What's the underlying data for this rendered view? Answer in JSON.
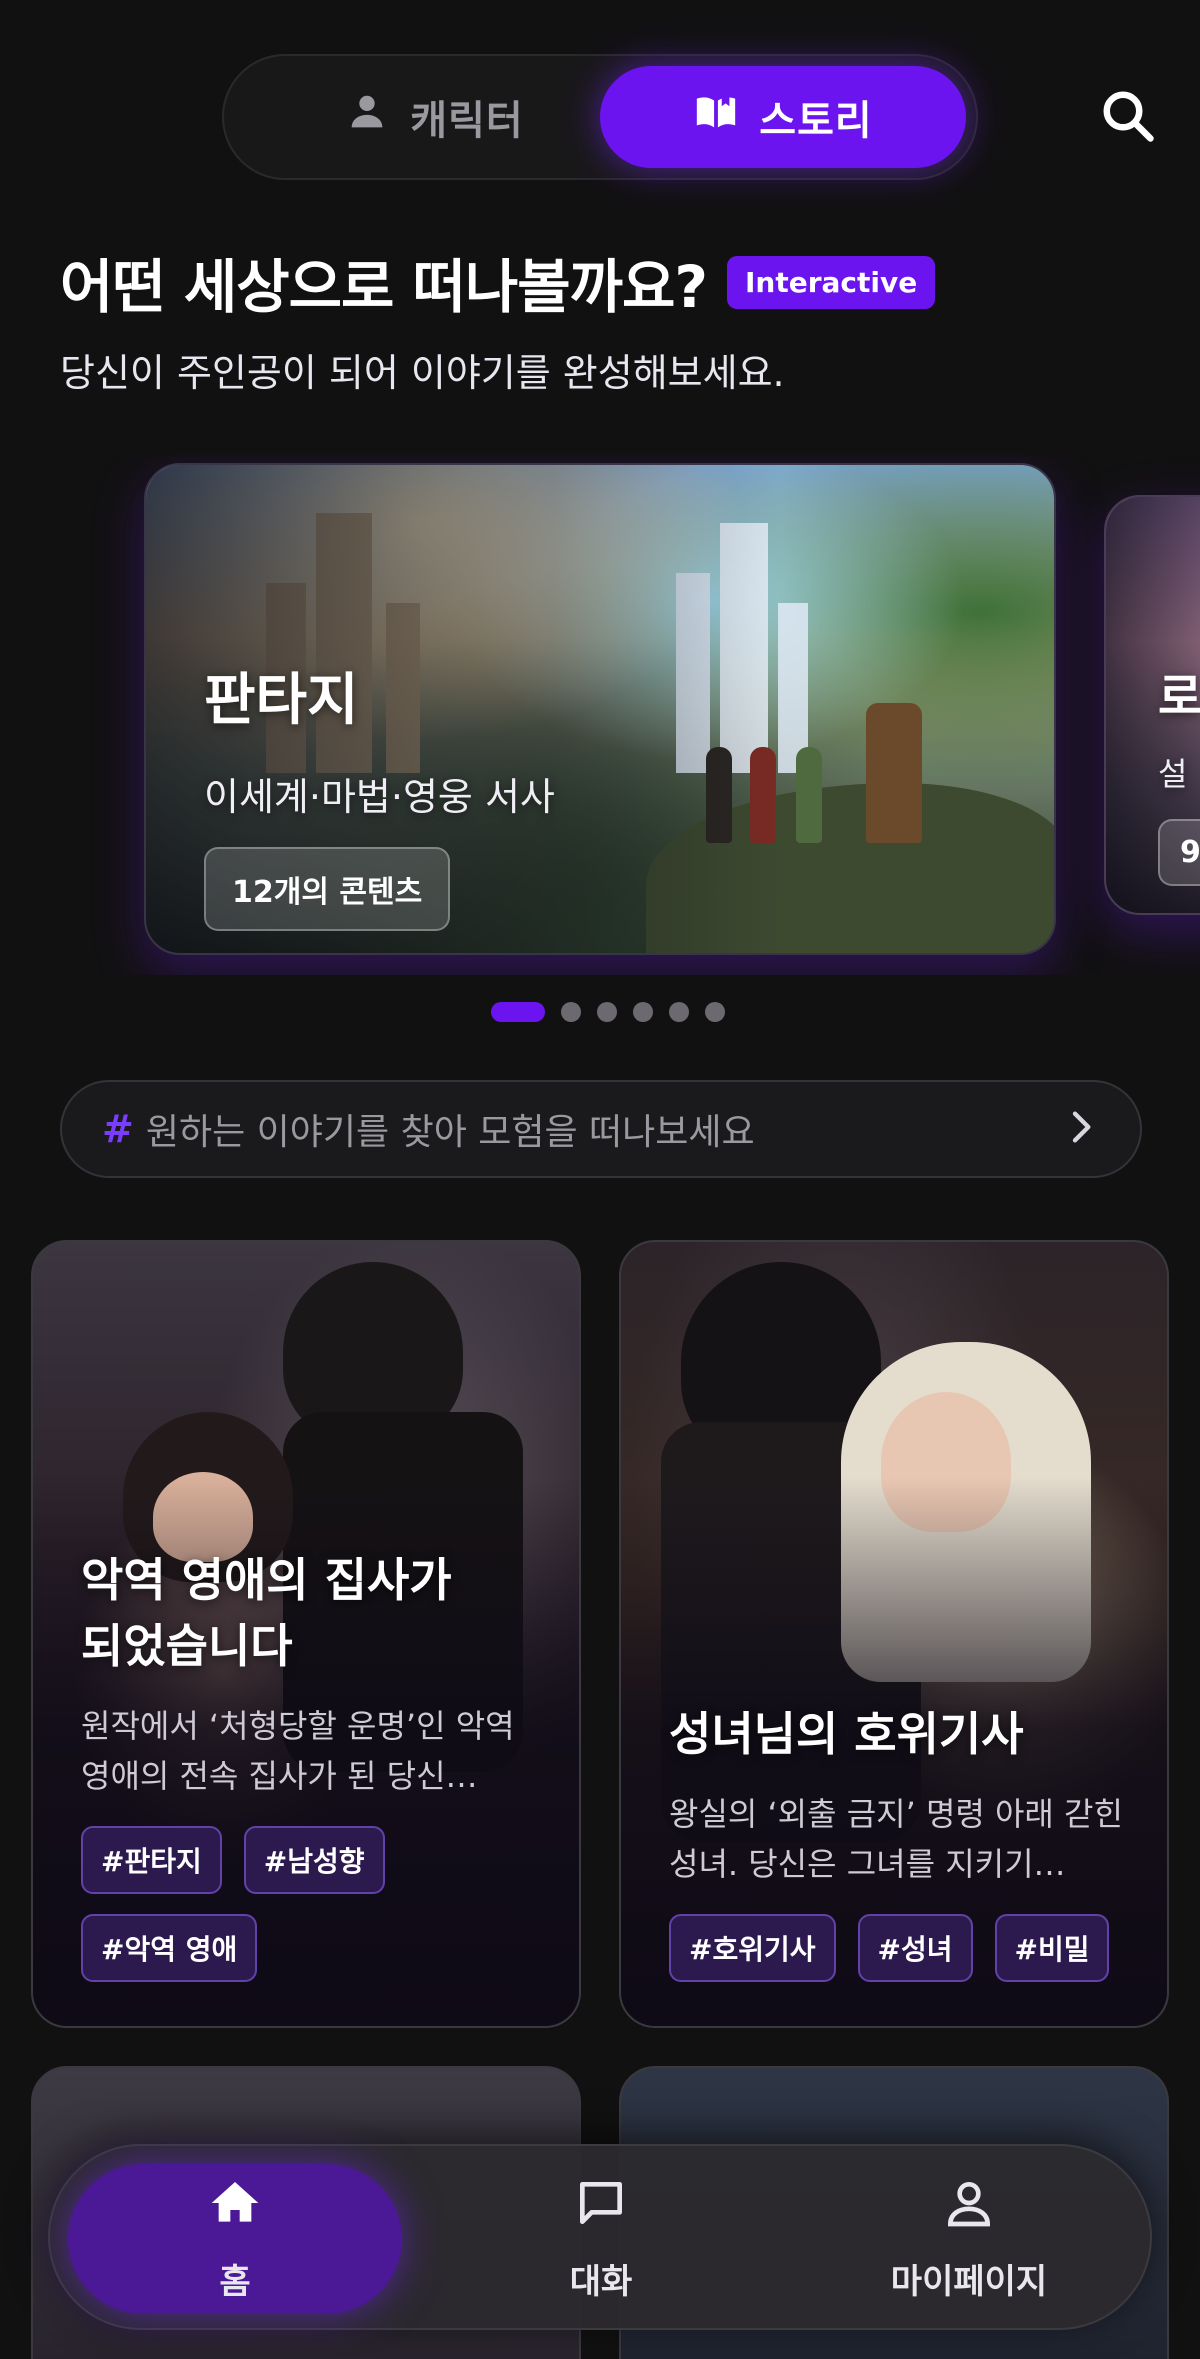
{
  "top_tabs": {
    "character": {
      "label": "캐릭터",
      "icon": "person-icon",
      "active": false
    },
    "story": {
      "label": "스토리",
      "icon": "book-open-icon",
      "active": true
    },
    "search_icon": "search-icon"
  },
  "header": {
    "title": "어떤 세상으로 떠나볼까요?",
    "badge": "Interactive",
    "subtitle": "당신이 주인공이 되어 이야기를 완성해보세요."
  },
  "carousel": {
    "slides": [
      {
        "title": "판타지",
        "description": "이세계·마법·영웅 서사",
        "count": "12개의 콘텐츠"
      },
      {
        "title": "로",
        "description": "설",
        "count": "9"
      }
    ],
    "page_count": 6,
    "active_index": 0
  },
  "tag_prompt": {
    "hash": "#",
    "text": "원하는 이야기를 찾아 모험을 떠나보세요",
    "arrow_icon": "chevron-right-icon"
  },
  "stories": [
    {
      "title_line1": "악역 영애의 집사가",
      "title_line2": "되었습니다",
      "description": "원작에서 ‘처형당할 운명’인 악역 영애의 전속 집사가 된 당신…",
      "tags": [
        "#판타지",
        "#남성향",
        "#악역 영애"
      ]
    },
    {
      "title_line1": "성녀님의 호위기사",
      "title_line2": "",
      "description": "왕실의 ‘외출 금지’ 명령 아래 갇힌 성녀. 당신은 그녀를 지키기…",
      "tags": [
        "#호위기사",
        "#성녀",
        "#비밀"
      ]
    }
  ],
  "bottom_nav": {
    "items": [
      {
        "label": "홈",
        "icon": "home-icon",
        "active": true
      },
      {
        "label": "대화",
        "icon": "chat-bubble-icon",
        "active": false
      },
      {
        "label": "마이페이지",
        "icon": "person-outline-icon",
        "active": false
      }
    ]
  },
  "colors": {
    "background": "#121112",
    "accent": "#6c14f0",
    "tag_background": "#2c1a4e",
    "tag_border": "#6242a8",
    "muted_text": "#9a99a0"
  }
}
